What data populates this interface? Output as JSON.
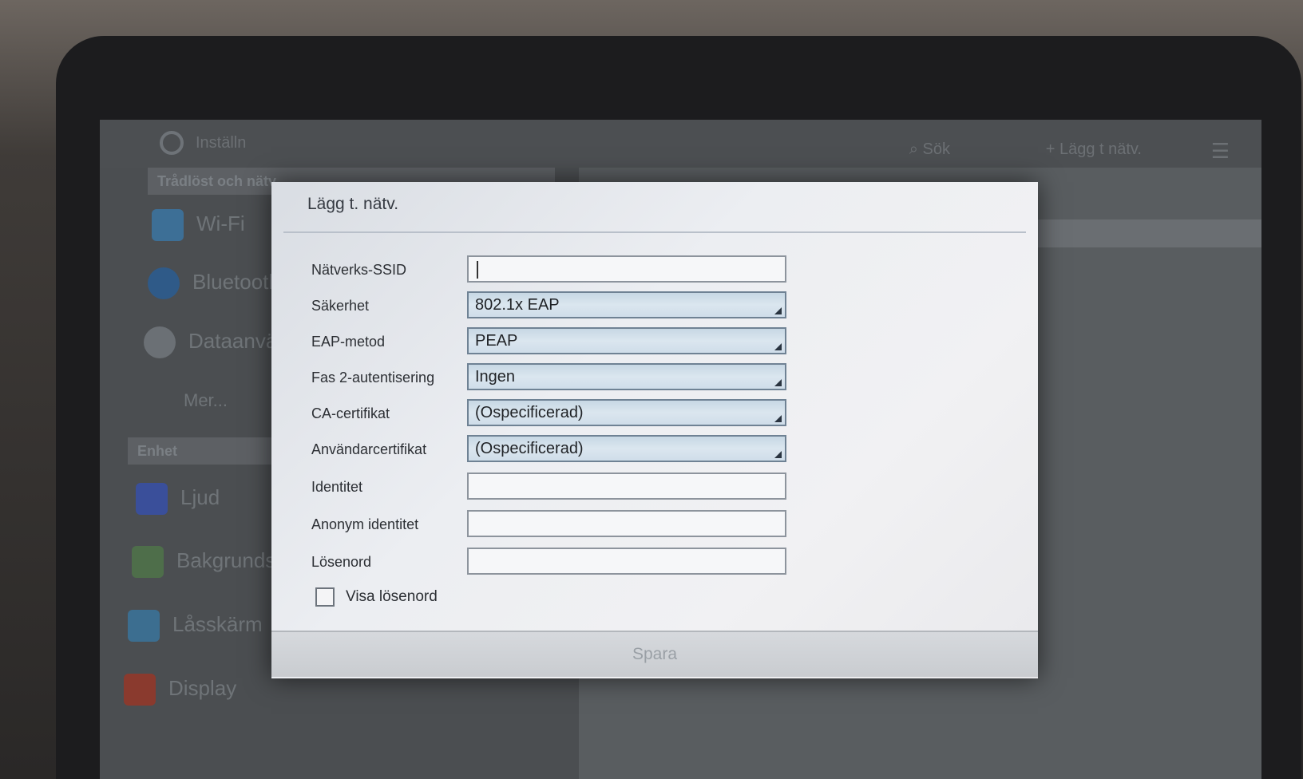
{
  "background_app": {
    "title": "Inställn",
    "search_label": "Sök",
    "add_network_label": "Lägg t nätv.",
    "sections": {
      "wireless": "Trådlöst och nätv",
      "device": "Enhet"
    },
    "items": [
      {
        "label": "Wi-Fi",
        "icon": "wifi-icon"
      },
      {
        "label": "Bluetooth",
        "icon": "bluetooth-icon"
      },
      {
        "label": "Dataanvän",
        "icon": "data-usage-icon"
      },
      {
        "label": "Mer..."
      },
      {
        "label": "Ljud",
        "icon": "sound-icon"
      },
      {
        "label": "Bakgrunds",
        "icon": "wallpaper-icon"
      },
      {
        "label": "Låsskärm",
        "icon": "lock-icon"
      },
      {
        "label": "Display",
        "icon": "display-icon"
      }
    ]
  },
  "dialog": {
    "title": "Lägg t. nätv.",
    "fields": {
      "ssid": {
        "label": "Nätverks-SSID",
        "value": ""
      },
      "security": {
        "label": "Säkerhet",
        "value": "802.1x EAP"
      },
      "eap_method": {
        "label": "EAP-metod",
        "value": "PEAP"
      },
      "phase2": {
        "label": "Fas 2-autentisering",
        "value": "Ingen"
      },
      "ca_cert": {
        "label": "CA-certifikat",
        "value": "(Ospecificerad)"
      },
      "user_cert": {
        "label": "Användarcertifikat",
        "value": "(Ospecificerad)"
      },
      "identity": {
        "label": "Identitet",
        "value": ""
      },
      "anon_identity": {
        "label": "Anonym identitet",
        "value": ""
      },
      "password": {
        "label": "Lösenord",
        "value": ""
      }
    },
    "show_password_label": "Visa lösenord",
    "save_label": "Spara"
  },
  "colors": {
    "spinner_bg": "#cfdde9",
    "dialog_bg": "#eceef2",
    "save_text_disabled": "#9aa0a6"
  }
}
